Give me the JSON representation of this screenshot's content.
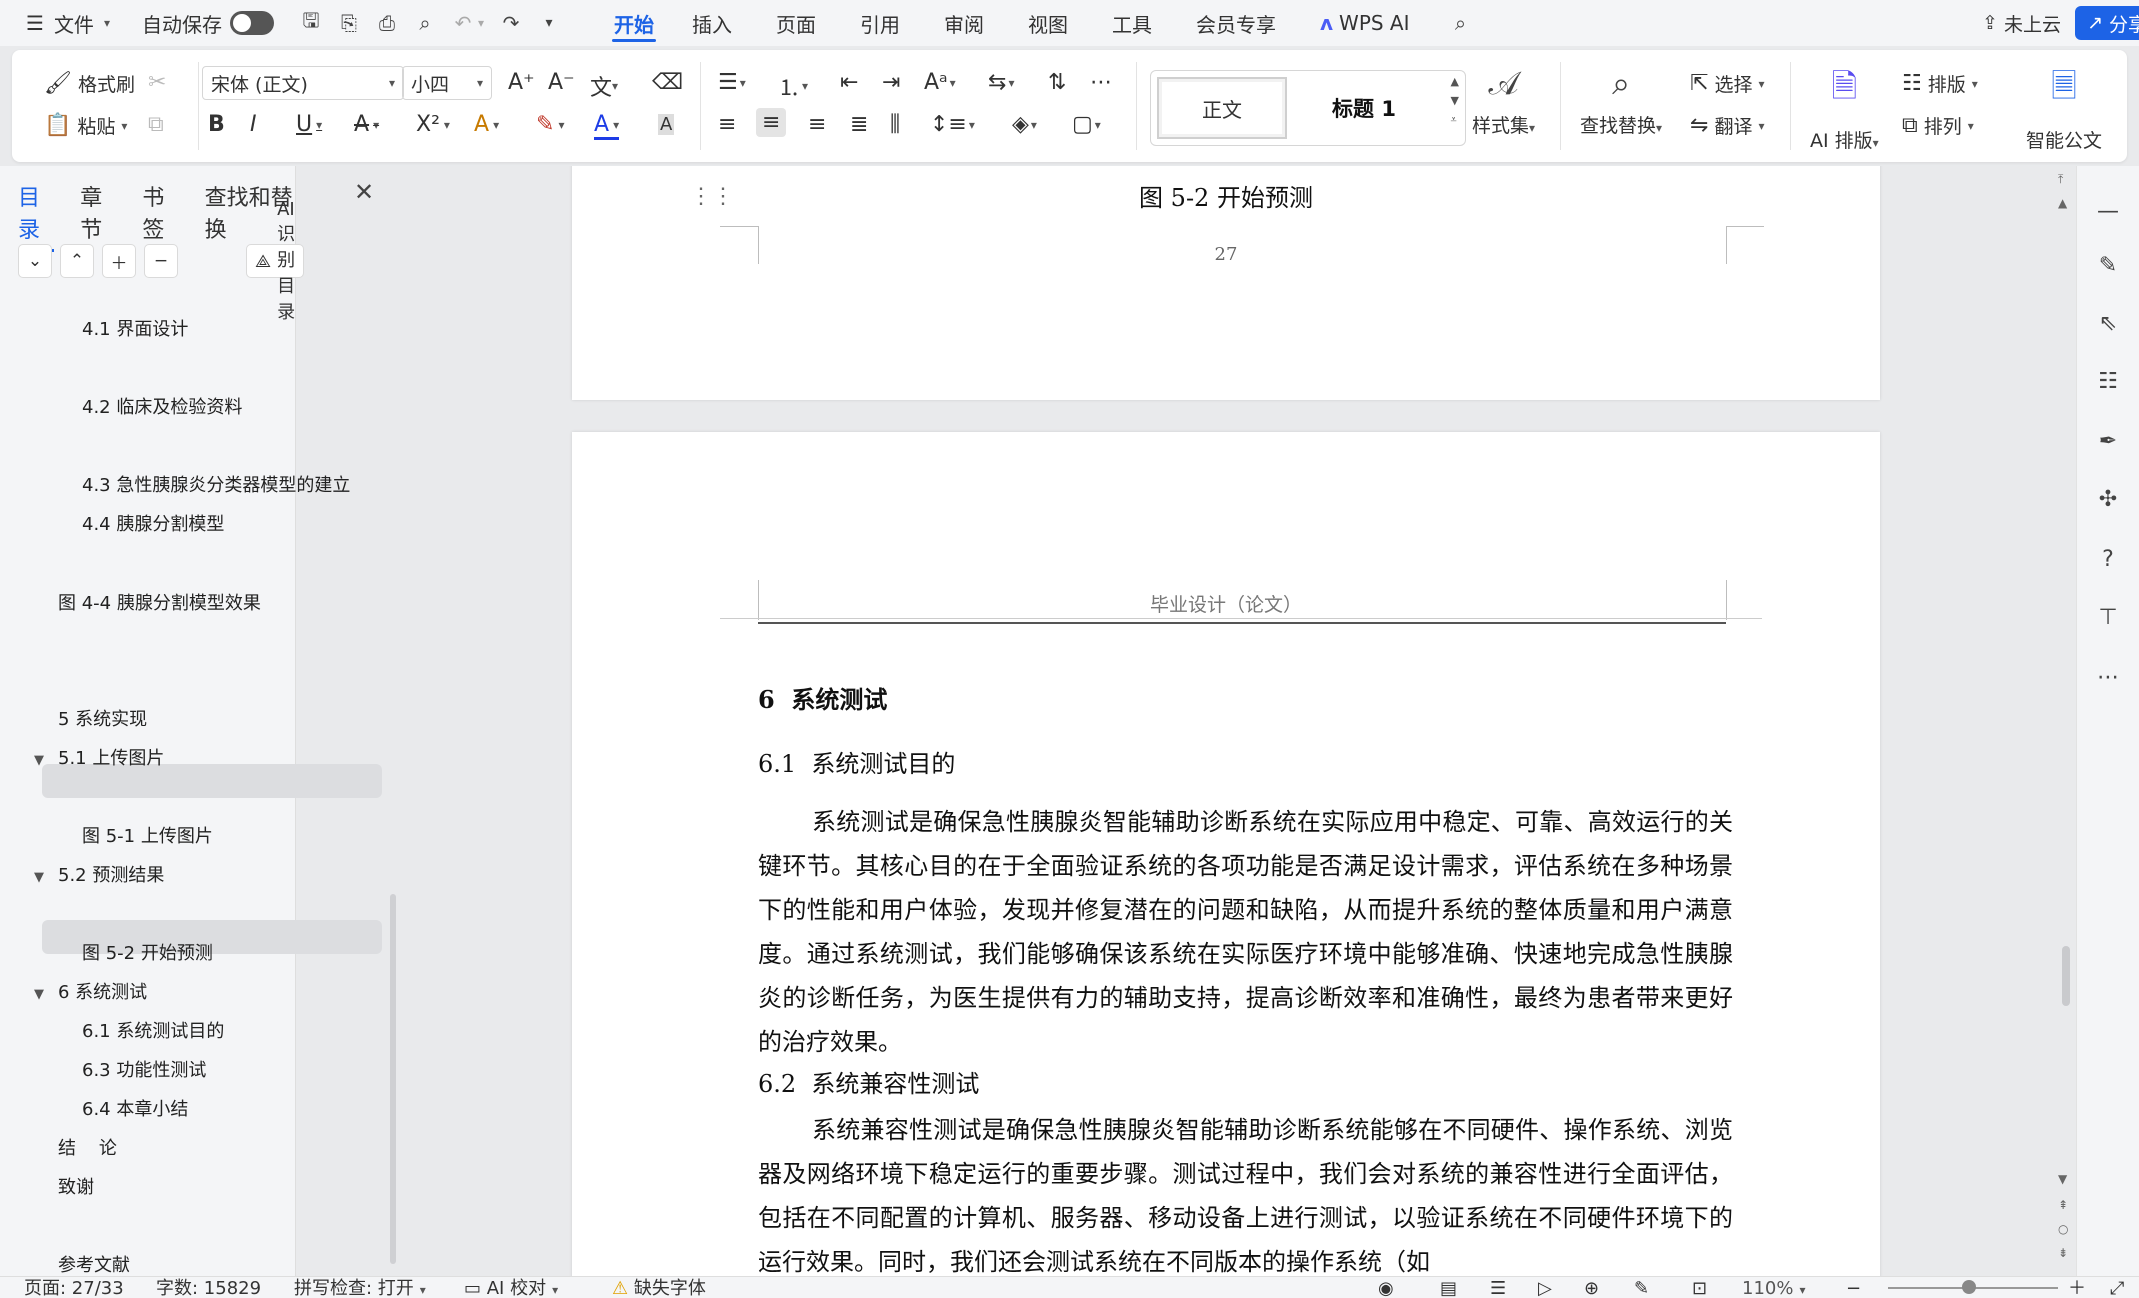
{
  "menubar": {
    "file": "文件",
    "autosave": "自动保存",
    "tabs": [
      "开始",
      "插入",
      "页面",
      "引用",
      "审阅",
      "视图",
      "工具",
      "会员专享"
    ],
    "active_tab": "开始",
    "wps_ai": "WPS AI",
    "cloud": "未上云",
    "share": "分享"
  },
  "ribbon": {
    "format_painter": "格式刷",
    "paste": "粘贴",
    "font_name": "宋体 (正文)",
    "font_size": "小四",
    "style_normal": "正文",
    "style_heading": "标题 1",
    "style_set": "样式集",
    "find_replace": "查找替换",
    "select": "选择",
    "translate": "翻译",
    "ai_layout": "AI 排版",
    "layout": "排版",
    "arrange": "排列",
    "smart_doc": "智能公文"
  },
  "nav": {
    "tabs": [
      "目录",
      "章节",
      "书签",
      "查找和替换"
    ],
    "active_tab": "目录",
    "ai_toc": "AI识别目录",
    "items": [
      {
        "label": "4.1  界面设计",
        "level": 2
      },
      {
        "label": "4.2 临床及检验资料",
        "level": 2
      },
      {
        "label": "4.3 急性胰腺炎分类器模型的建立",
        "level": 2
      },
      {
        "label": "4.4  胰腺分割模型",
        "level": 2
      },
      {
        "label": "图 4-4  胰腺分割模型效果",
        "level": 1
      },
      {
        "label": "5 系统实现",
        "level": 1
      },
      {
        "label": "5.1  上传图片",
        "level": 1,
        "expanded": true
      },
      {
        "label": "图 5-1  上传图片",
        "level": 2
      },
      {
        "label": "5.2  预测结果",
        "level": 1,
        "expanded": true
      },
      {
        "label": "图 5-2  开始预测",
        "level": 2,
        "selected": true
      },
      {
        "label": "6  系统测试",
        "level": 1,
        "expanded": true
      },
      {
        "label": "6.1  系统测试目的",
        "level": 2
      },
      {
        "label": "6.3  功能性测试",
        "level": 2
      },
      {
        "label": "6.4  本章小结",
        "level": 2
      },
      {
        "label": "结    论",
        "level": 1
      },
      {
        "label": "致谢",
        "level": 1
      },
      {
        "label": "参考文献",
        "level": 1
      }
    ]
  },
  "document": {
    "page1": {
      "caption": "图 5-2  开始预测",
      "page_number": "27"
    },
    "page2": {
      "header": "毕业设计（论文）",
      "heading1": "6  系统测试",
      "heading2a": "6.1  系统测试目的",
      "para1": "系统测试是确保急性胰腺炎智能辅助诊断系统在实际应用中稳定、可靠、高效运行的关键环节。其核心目的在于全面验证系统的各项功能是否满足设计需求，评估系统在多种场景下的性能和用户体验，发现并修复潜在的问题和缺陷，从而提升系统的整体质量和用户满意度。通过系统测试，我们能够确保该系统在实际医疗环境中能够准确、快速地完成急性胰腺炎的诊断任务，为医生提供有力的辅助支持，提高诊断效率和准确性，最终为患者带来更好的治疗效果。",
      "heading2b": "6.2  系统兼容性测试",
      "para2": "系统兼容性测试是确保急性胰腺炎智能辅助诊断系统能够在不同硬件、操作系统、浏览器及网络环境下稳定运行的重要步骤。测试过程中，我们会对系统的兼容性进行全面评估，包括在不同配置的计算机、服务器、移动设备上进行测试，以验证系统在不同硬件环境下的运行效果。同时，我们还会测试系统在不同版本的操作系统（如"
    }
  },
  "status": {
    "page": "页面: 27/33",
    "words": "字数: 15829",
    "spell": "拼写检查: 打开",
    "ai_proof": "AI 校对",
    "missing_font": "缺失字体",
    "zoom": "110%"
  },
  "colors": {
    "accent": "#1d63e6",
    "selected_row": "#dcdde0"
  }
}
